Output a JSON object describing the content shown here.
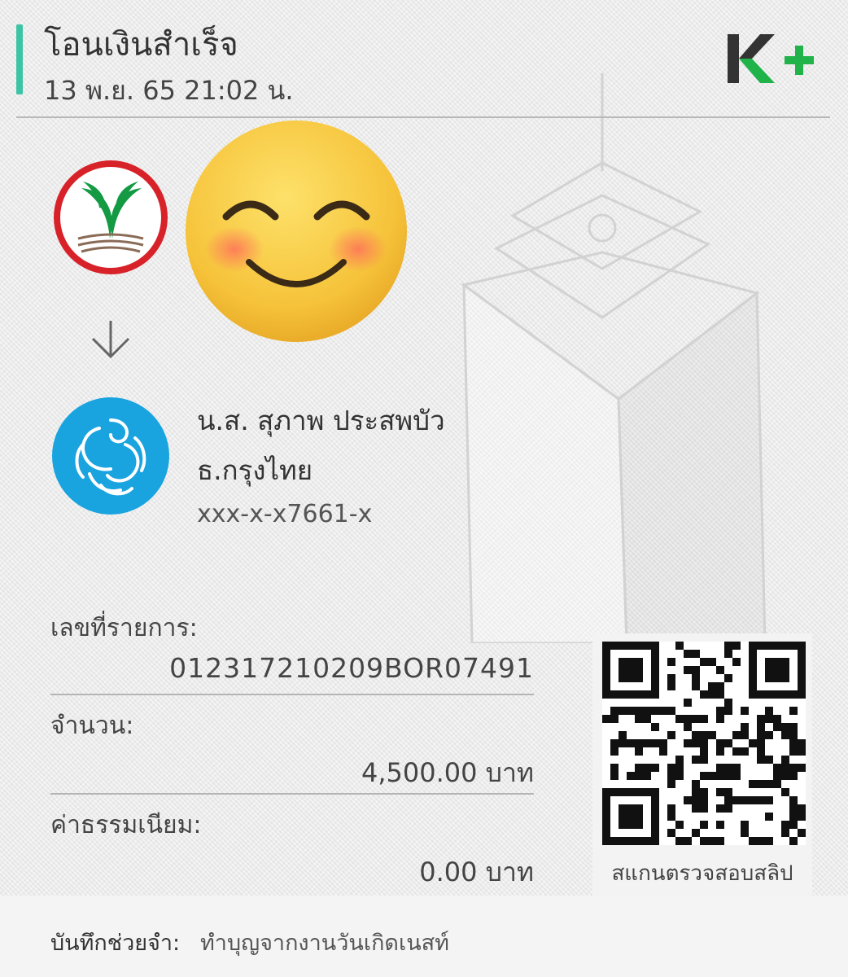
{
  "header": {
    "title": "โอนเงินสำเร็จ",
    "datetime": "13 พ.ย. 65  21:02 น.",
    "brand_logo": "K+",
    "accent_color": "#3cc4a5",
    "brand_green": "#1fb34a"
  },
  "sender": {
    "bank_icon": "kasikorn-logo",
    "name_obscured": "emoji-smiling-face"
  },
  "receiver": {
    "name": "น.ส. สุภาพ ประสพบัว",
    "bank": "ธ.กรุงไทย",
    "account": "xxx-x-x7661-x",
    "bank_icon": "krungthai-logo"
  },
  "details": {
    "ref_label": "เลขที่รายการ:",
    "ref_value": "012317210209BOR07491",
    "amount_label": "จำนวน:",
    "amount_value": "4,500.00 บาท",
    "fee_label": "ค่าธรรมเนียม:",
    "fee_value": "0.00 บาท"
  },
  "qr": {
    "caption": "สแกนตรวจสอบสลิป"
  },
  "footer": {
    "memo_label": "บันทึกช่วยจำ:",
    "memo_value": "ทำบุญจากงานวันเกิดเนสท์"
  }
}
